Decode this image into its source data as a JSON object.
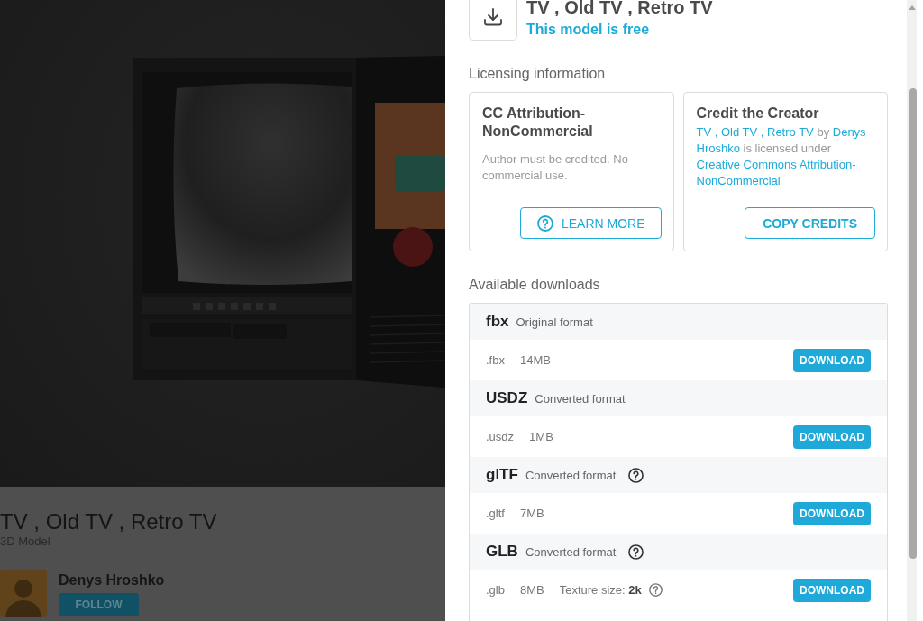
{
  "background_page": {
    "title": "TV , Old TV , Retro TV",
    "subtitle": "3D Model",
    "author": {
      "name": "Denys Hroshko",
      "follow_button": "FOLLOW"
    }
  },
  "dialog": {
    "title": "TV , Old TV , Retro TV",
    "price_note": "This model is free",
    "licensing": {
      "heading": "Licensing information",
      "license": {
        "title": "CC Attribution-NonCommercial",
        "description": "Author must be credited. No commercial use.",
        "button": "LEARN MORE"
      },
      "credit": {
        "title": "Credit the Creator",
        "text": [
          {
            "kind": "link",
            "text": "TV , Old TV , Retro TV"
          },
          {
            "kind": "plain",
            "text": "by"
          },
          {
            "kind": "link",
            "text": "Denys"
          },
          {
            "kind": "link",
            "text": "Hroshko"
          },
          {
            "kind": "plain",
            "text": "is licensed under"
          },
          {
            "kind": "link",
            "text": "Creative Commons Attribution-"
          },
          {
            "kind": "link",
            "text": "NonCommercial"
          }
        ],
        "button": "COPY CREDITS"
      }
    },
    "downloads": {
      "heading": "Available downloads",
      "formats": [
        {
          "name": "fbx",
          "note": "Original format",
          "help": false,
          "files": [
            {
              "extension": ".fbx",
              "size": "14MB",
              "help": false,
              "button": "DOWNLOAD"
            }
          ]
        },
        {
          "name": "USDZ",
          "note": "Converted format",
          "help": false,
          "files": [
            {
              "extension": ".usdz",
              "size": "1MB",
              "help": false,
              "button": "DOWNLOAD"
            }
          ]
        },
        {
          "name": "glTF",
          "note": "Converted format",
          "help": true,
          "files": [
            {
              "extension": ".gltf",
              "size": "7MB",
              "help": false,
              "button": "DOWNLOAD"
            }
          ]
        },
        {
          "name": "GLB",
          "note": "Converted format",
          "help": true,
          "files": [
            {
              "extension": ".glb",
              "size": "8MB",
              "texture": "Texture size: **2k**",
              "help": true,
              "button": "DOWNLOAD"
            }
          ]
        }
      ]
    }
  }
}
